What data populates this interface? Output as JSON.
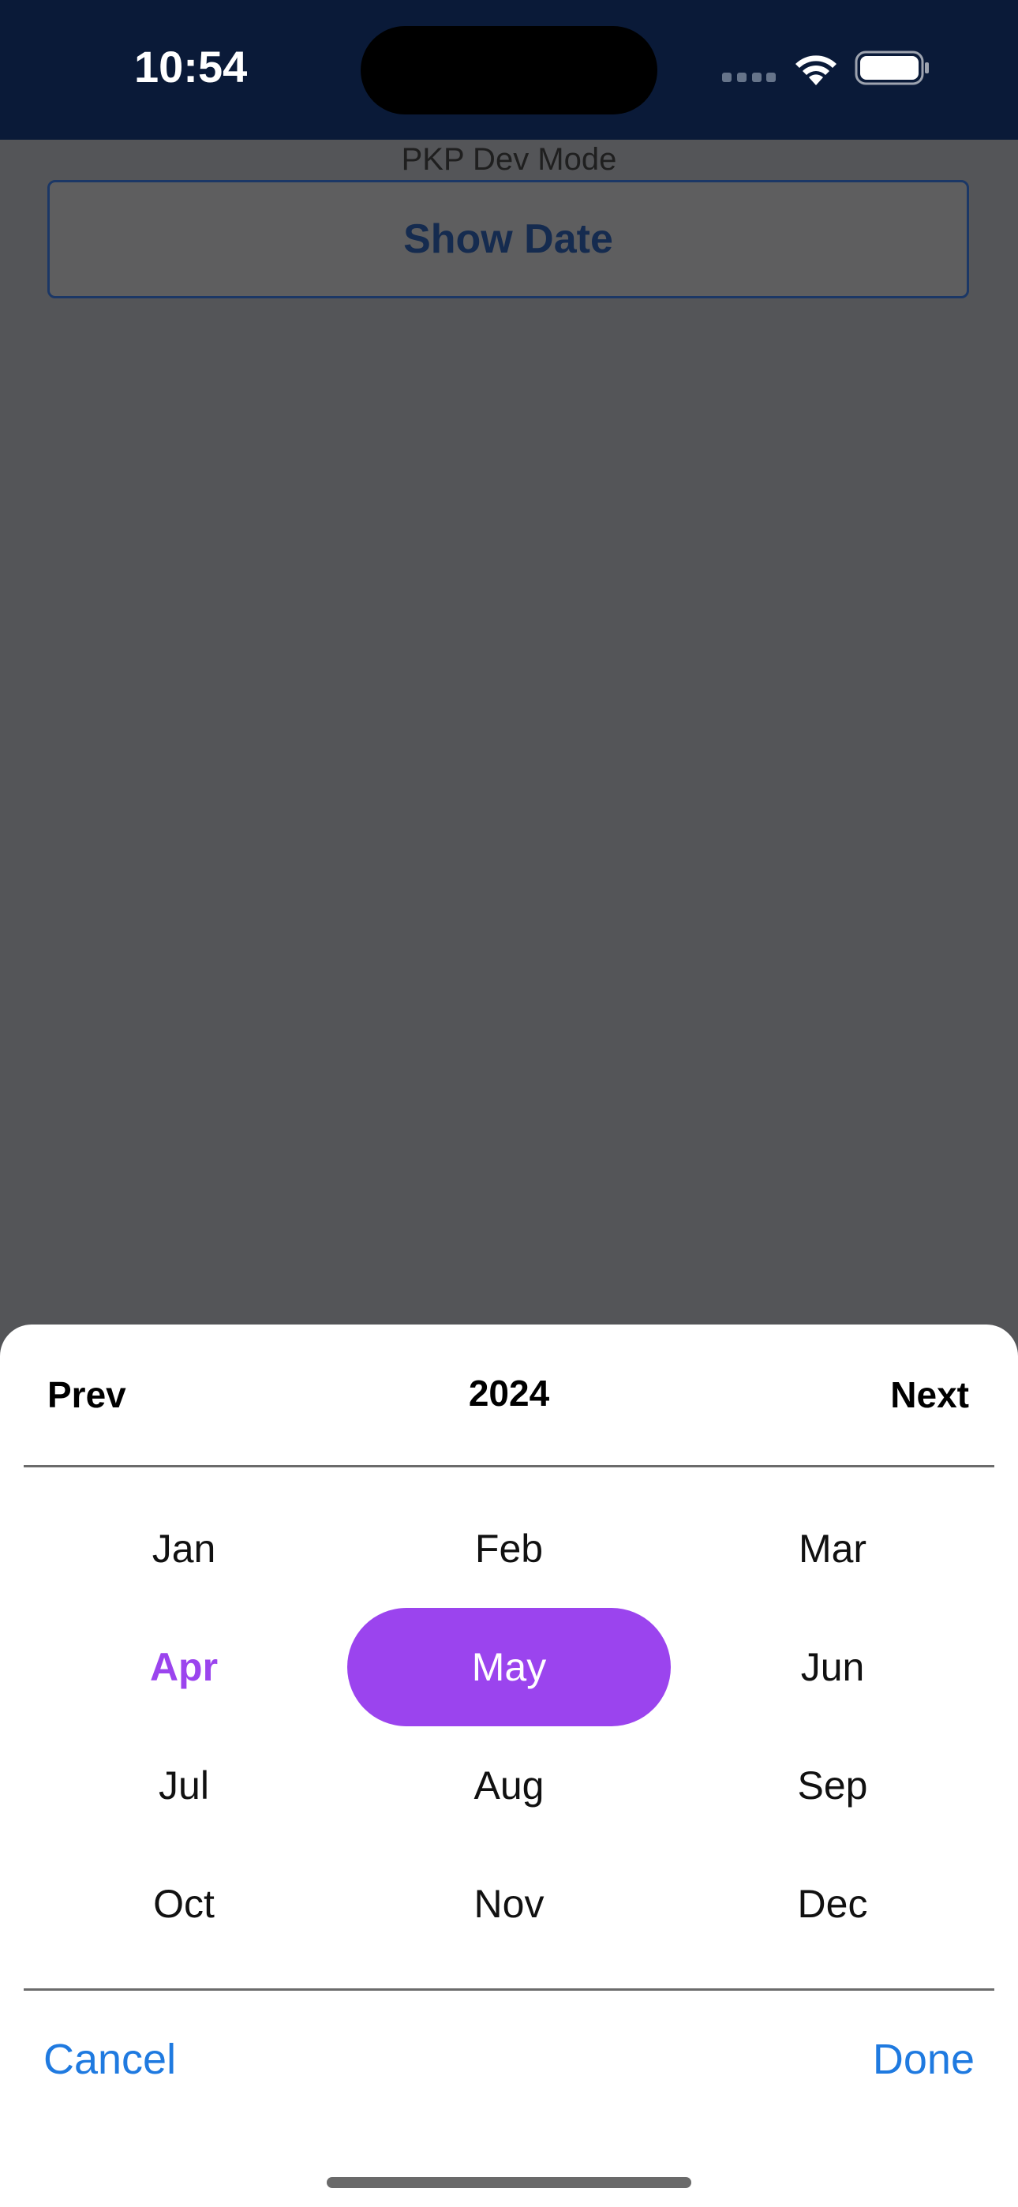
{
  "status_bar": {
    "time": "10:54",
    "icons": [
      "cellular-signal-icon",
      "wifi-icon",
      "battery-icon"
    ]
  },
  "app": {
    "mode_label": "PKP Dev Mode",
    "show_date_label": "Show Date"
  },
  "picker": {
    "prev_label": "Prev",
    "year": "2024",
    "next_label": "Next",
    "months": [
      "Jan",
      "Feb",
      "Mar",
      "Apr",
      "May",
      "Jun",
      "Jul",
      "Aug",
      "Sep",
      "Oct",
      "Nov",
      "Dec"
    ],
    "current_month": "Apr",
    "selected_month": "May",
    "cancel_label": "Cancel",
    "done_label": "Done"
  },
  "colors": {
    "accent": "#9b44ee",
    "action": "#1f7ae0",
    "status_bar_bg": "#0a1a38",
    "overlay_bg": "#545558"
  }
}
